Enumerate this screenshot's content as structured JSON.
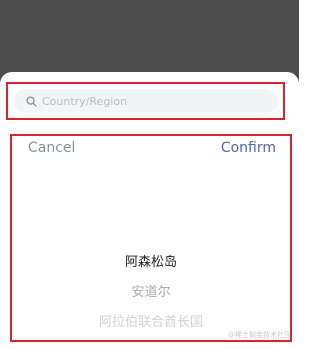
{
  "search": {
    "placeholder": "Country/Region"
  },
  "picker": {
    "cancel_label": "Cancel",
    "confirm_label": "Confirm",
    "items": [
      {
        "label": "阿森松岛",
        "state": "selected"
      },
      {
        "label": "安道尔",
        "state": "near"
      },
      {
        "label": "阿拉伯联合酋长国",
        "state": "far"
      }
    ]
  },
  "watermark": {
    "text": "@稀土掘金技术社区"
  },
  "colors": {
    "overlay": "#4d4d4d",
    "highlight_border": "#d9232d",
    "confirm": "#4e6ba6",
    "cancel": "#8a8f99"
  }
}
